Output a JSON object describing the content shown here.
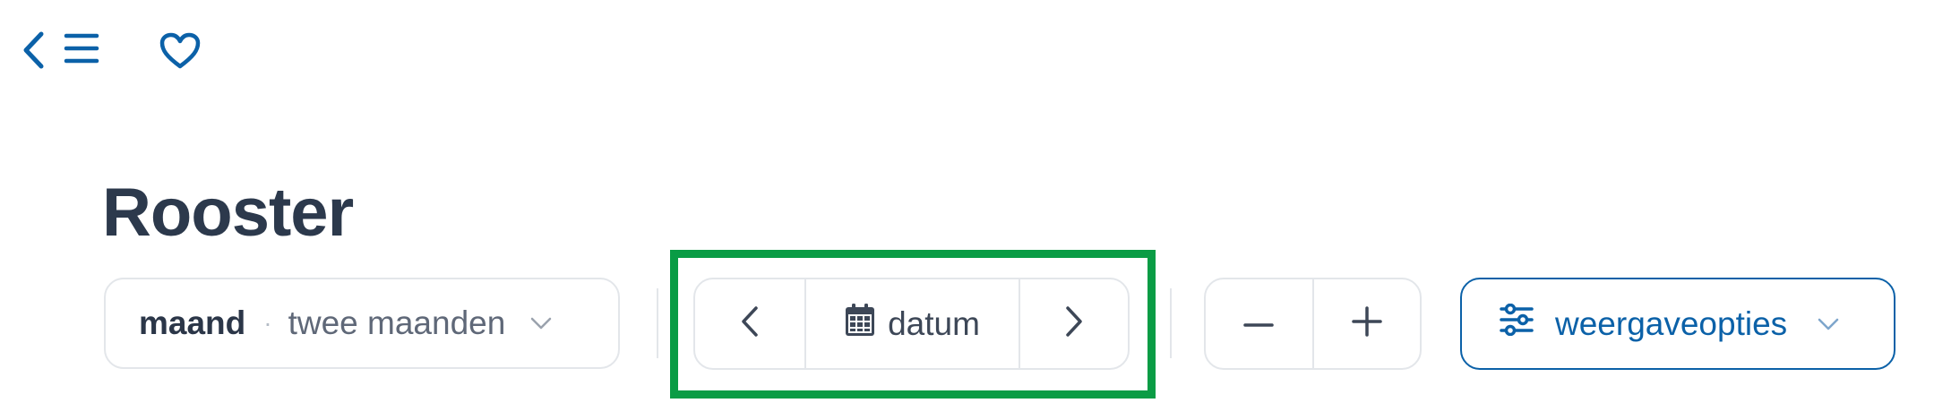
{
  "page": {
    "title": "Rooster"
  },
  "topbar": {
    "icons": [
      "chevron-left-icon",
      "menu-icon",
      "heart-icon"
    ]
  },
  "view_selector": {
    "selected": "maand",
    "separator": "·",
    "other": "twee maanden"
  },
  "date_nav": {
    "date_label": "datum"
  },
  "display_options": {
    "label": "weergaveopties"
  },
  "colors": {
    "accent": "#0b61a8",
    "highlight": "#0a9c45",
    "border": "#e3e6ea",
    "title": "#2c394c"
  }
}
